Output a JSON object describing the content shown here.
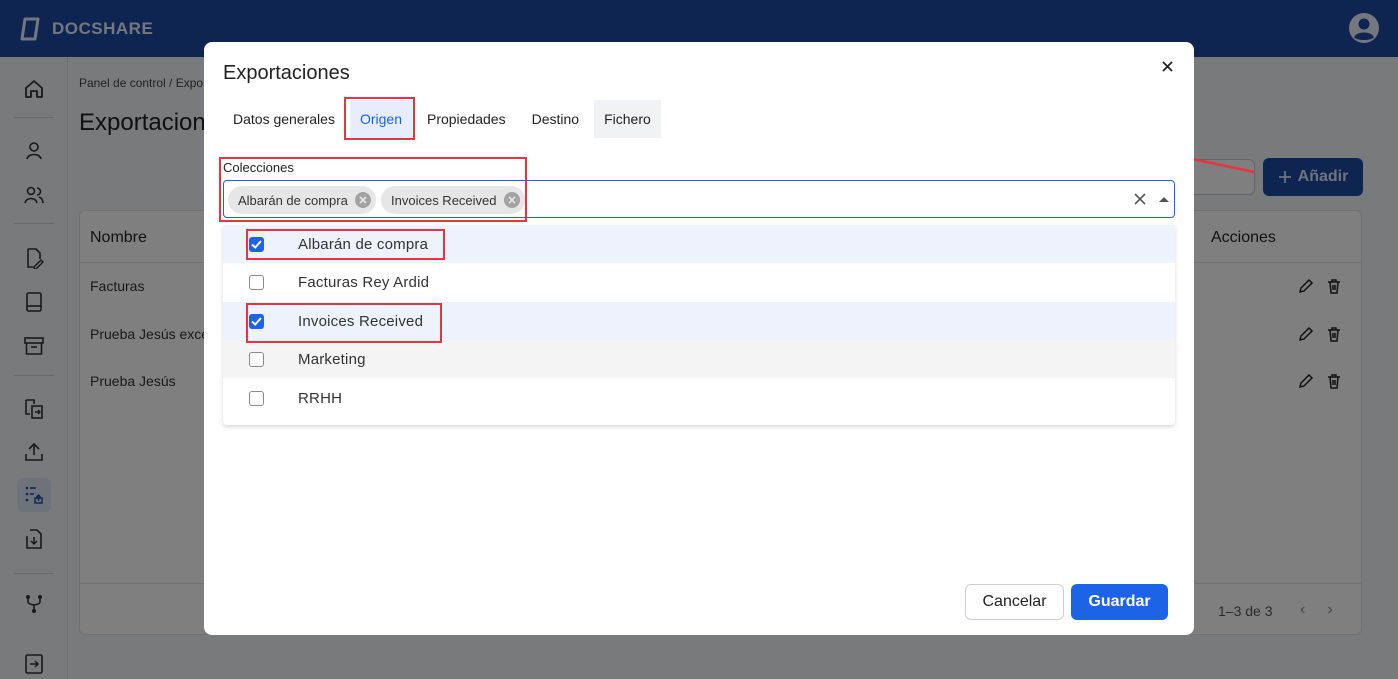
{
  "app": {
    "name": "DOCSHARE"
  },
  "background": {
    "breadcrumb": "Panel de control  /  Expo",
    "title": "Exportacion",
    "add_button": "Añadir",
    "table": {
      "headers": {
        "name": "Nombre",
        "actions": "Acciones"
      },
      "rows": [
        {
          "name": "Facturas"
        },
        {
          "name": "Prueba Jesús excel"
        },
        {
          "name": "Prueba Jesús"
        }
      ],
      "pagination": "1–3 de 3"
    }
  },
  "modal": {
    "title": "Exportaciones",
    "tabs": [
      {
        "label": "Datos generales"
      },
      {
        "label": "Origen"
      },
      {
        "label": "Propiedades"
      },
      {
        "label": "Destino"
      },
      {
        "label": "Fichero"
      }
    ],
    "active_tab": "Origen",
    "collections": {
      "label": "Colecciones",
      "selected_chips": [
        "Albarán de compra",
        "Invoices Received"
      ],
      "options": [
        {
          "label": "Albarán de compra",
          "checked": true
        },
        {
          "label": "Facturas Rey Ardid",
          "checked": false
        },
        {
          "label": "Invoices Received",
          "checked": true
        },
        {
          "label": "Marketing",
          "checked": false
        },
        {
          "label": "RRHH",
          "checked": false
        }
      ]
    },
    "cancel_label": "Cancelar",
    "save_label": "Guardar"
  },
  "colors": {
    "brand": "#1c4aa3",
    "primary": "#1c63e8",
    "highlight": "#e8343f"
  },
  "icons": [
    "docshare-logo-icon",
    "user-account-icon",
    "home-icon",
    "person-icon",
    "group-icon",
    "document-edit-icon",
    "book-icon",
    "archive-icon",
    "transfer-icon",
    "upload-icon",
    "export-list-icon",
    "download-icon",
    "workflow-icon",
    "logout-icon",
    "close-icon",
    "chip-remove-icon",
    "clear-icon",
    "caret-up-icon",
    "edit-icon",
    "trash-icon",
    "plus-icon"
  ]
}
